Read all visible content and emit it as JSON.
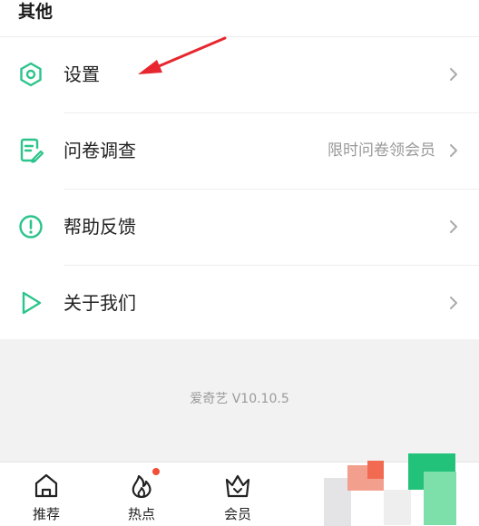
{
  "section": {
    "title": "其他"
  },
  "menu": {
    "items": [
      {
        "label": "设置",
        "hint": "",
        "icon": "settings-hexagon-icon"
      },
      {
        "label": "问卷调查",
        "hint": "限时问卷领会员",
        "icon": "survey-document-icon"
      },
      {
        "label": "帮助反馈",
        "hint": "",
        "icon": "help-exclamation-icon"
      },
      {
        "label": "关于我们",
        "hint": "",
        "icon": "about-play-icon"
      }
    ]
  },
  "footer": {
    "version": "爱奇艺 V10.10.5"
  },
  "bottom_nav": {
    "tabs": [
      {
        "label": "推荐",
        "icon": "home-icon"
      },
      {
        "label": "热点",
        "icon": "flame-icon",
        "badge": true
      },
      {
        "label": "会员",
        "icon": "crown-icon"
      }
    ]
  },
  "colors": {
    "accent": "#2bc48a",
    "badge": "#f24d36",
    "annotation_arrow": "#e8262f"
  }
}
